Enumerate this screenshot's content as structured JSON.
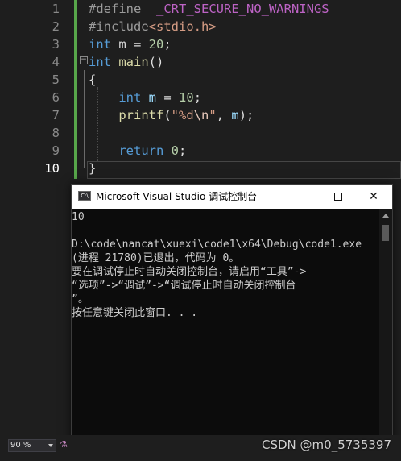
{
  "editor": {
    "line_numbers": [
      "1",
      "2",
      "3",
      "4",
      "5",
      "6",
      "7",
      "8",
      "9",
      "10"
    ],
    "lines": [
      {
        "tokens": [
          {
            "t": "#define",
            "c": "pp"
          },
          {
            "t": "  ",
            "c": ""
          },
          {
            "t": "_CRT_SECURE_NO_WARNINGS",
            "c": "macro"
          }
        ]
      },
      {
        "tokens": [
          {
            "t": "#include",
            "c": "pp"
          },
          {
            "t": "<stdio.h>",
            "c": "str"
          }
        ]
      },
      {
        "tokens": [
          {
            "t": "int",
            "c": "kw"
          },
          {
            "t": " m = ",
            "c": ""
          },
          {
            "t": "20",
            "c": "num"
          },
          {
            "t": ";",
            "c": ""
          }
        ]
      },
      {
        "tokens": [
          {
            "t": "int",
            "c": "kw"
          },
          {
            "t": " ",
            "c": ""
          },
          {
            "t": "main",
            "c": "fn"
          },
          {
            "t": "()",
            "c": ""
          }
        ]
      },
      {
        "tokens": [
          {
            "t": "{",
            "c": ""
          }
        ]
      },
      {
        "tokens": [
          {
            "t": "    ",
            "c": ""
          },
          {
            "t": "int",
            "c": "kw"
          },
          {
            "t": " ",
            "c": ""
          },
          {
            "t": "m",
            "c": "var"
          },
          {
            "t": " = ",
            "c": ""
          },
          {
            "t": "10",
            "c": "num"
          },
          {
            "t": ";",
            "c": ""
          }
        ]
      },
      {
        "tokens": [
          {
            "t": "    ",
            "c": ""
          },
          {
            "t": "printf",
            "c": "fn"
          },
          {
            "t": "(",
            "c": ""
          },
          {
            "t": "\"%d",
            "c": "str"
          },
          {
            "t": "\\n",
            "c": "esc"
          },
          {
            "t": "\"",
            "c": "str"
          },
          {
            "t": ", ",
            "c": ""
          },
          {
            "t": "m",
            "c": "var"
          },
          {
            "t": ");",
            "c": ""
          }
        ]
      },
      {
        "tokens": []
      },
      {
        "tokens": [
          {
            "t": "    ",
            "c": ""
          },
          {
            "t": "return",
            "c": "kw"
          },
          {
            "t": " ",
            "c": ""
          },
          {
            "t": "0",
            "c": "num"
          },
          {
            "t": ";",
            "c": ""
          }
        ]
      },
      {
        "tokens": [
          {
            "t": "}",
            "c": ""
          }
        ]
      }
    ],
    "current_line": 10,
    "change_bar_color": "#57a64a"
  },
  "console": {
    "title": "Microsoft Visual Studio 调试控制台",
    "icon_text": "C:\\",
    "minimize_label": "minimize",
    "maximize_label": "maximize",
    "close_label": "✕",
    "output_lines": [
      "10",
      "",
      "D:\\code\\nancat\\xuexi\\code1\\x64\\Debug\\code1.exe",
      "(进程 21780)已退出，代码为 0。",
      "要在调试停止时自动关闭控制台，请启用“工具”->",
      "“选项”->“调试”->“调试停止时自动关闭控制台",
      "”。",
      "按任意键关闭此窗口. . ."
    ]
  },
  "status": {
    "zoom": "90 %",
    "watermark": "CSDN @m0_5735397"
  }
}
